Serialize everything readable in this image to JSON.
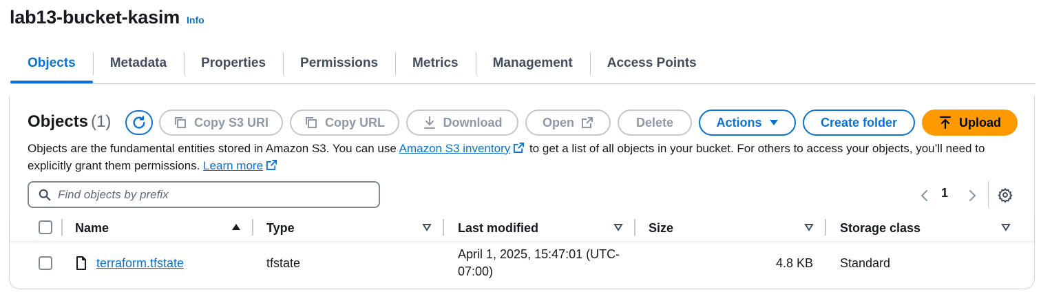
{
  "header": {
    "bucket_name": "lab13-bucket-kasim",
    "info_label": "Info"
  },
  "tabs": [
    {
      "label": "Objects",
      "active": true
    },
    {
      "label": "Metadata",
      "active": false
    },
    {
      "label": "Properties",
      "active": false
    },
    {
      "label": "Permissions",
      "active": false
    },
    {
      "label": "Metrics",
      "active": false
    },
    {
      "label": "Management",
      "active": false
    },
    {
      "label": "Access Points",
      "active": false
    }
  ],
  "objects_panel": {
    "heading": "Objects",
    "count": "(1)",
    "toolbar": {
      "copy_s3_uri": "Copy S3 URI",
      "copy_url": "Copy URL",
      "download": "Download",
      "open": "Open",
      "delete": "Delete",
      "actions": "Actions",
      "create_folder": "Create folder",
      "upload": "Upload"
    },
    "description": {
      "text1": "Objects are the fundamental entities stored in Amazon S3. You can use ",
      "link1": "Amazon S3 inventory",
      "text2": " to get a list of all objects in your bucket. For others to access your objects, you’ll need to explicitly grant them permissions. ",
      "link2": "Learn more"
    },
    "search": {
      "placeholder": "Find objects by prefix",
      "value": ""
    },
    "pagination": {
      "current_page": "1"
    }
  },
  "table": {
    "columns": [
      "Name",
      "Type",
      "Last modified",
      "Size",
      "Storage class"
    ],
    "rows": [
      {
        "name": "terraform.tfstate",
        "type": "tfstate",
        "last_modified_line1": "April 1, 2025, 15:47:01 (UTC-",
        "last_modified_line2": "07:00)",
        "size": "4.8 KB",
        "storage_class": "Standard"
      }
    ]
  },
  "colors": {
    "accent": "#0972d3",
    "primary_button": "#ff9900",
    "disabled": "#8d99a8"
  }
}
